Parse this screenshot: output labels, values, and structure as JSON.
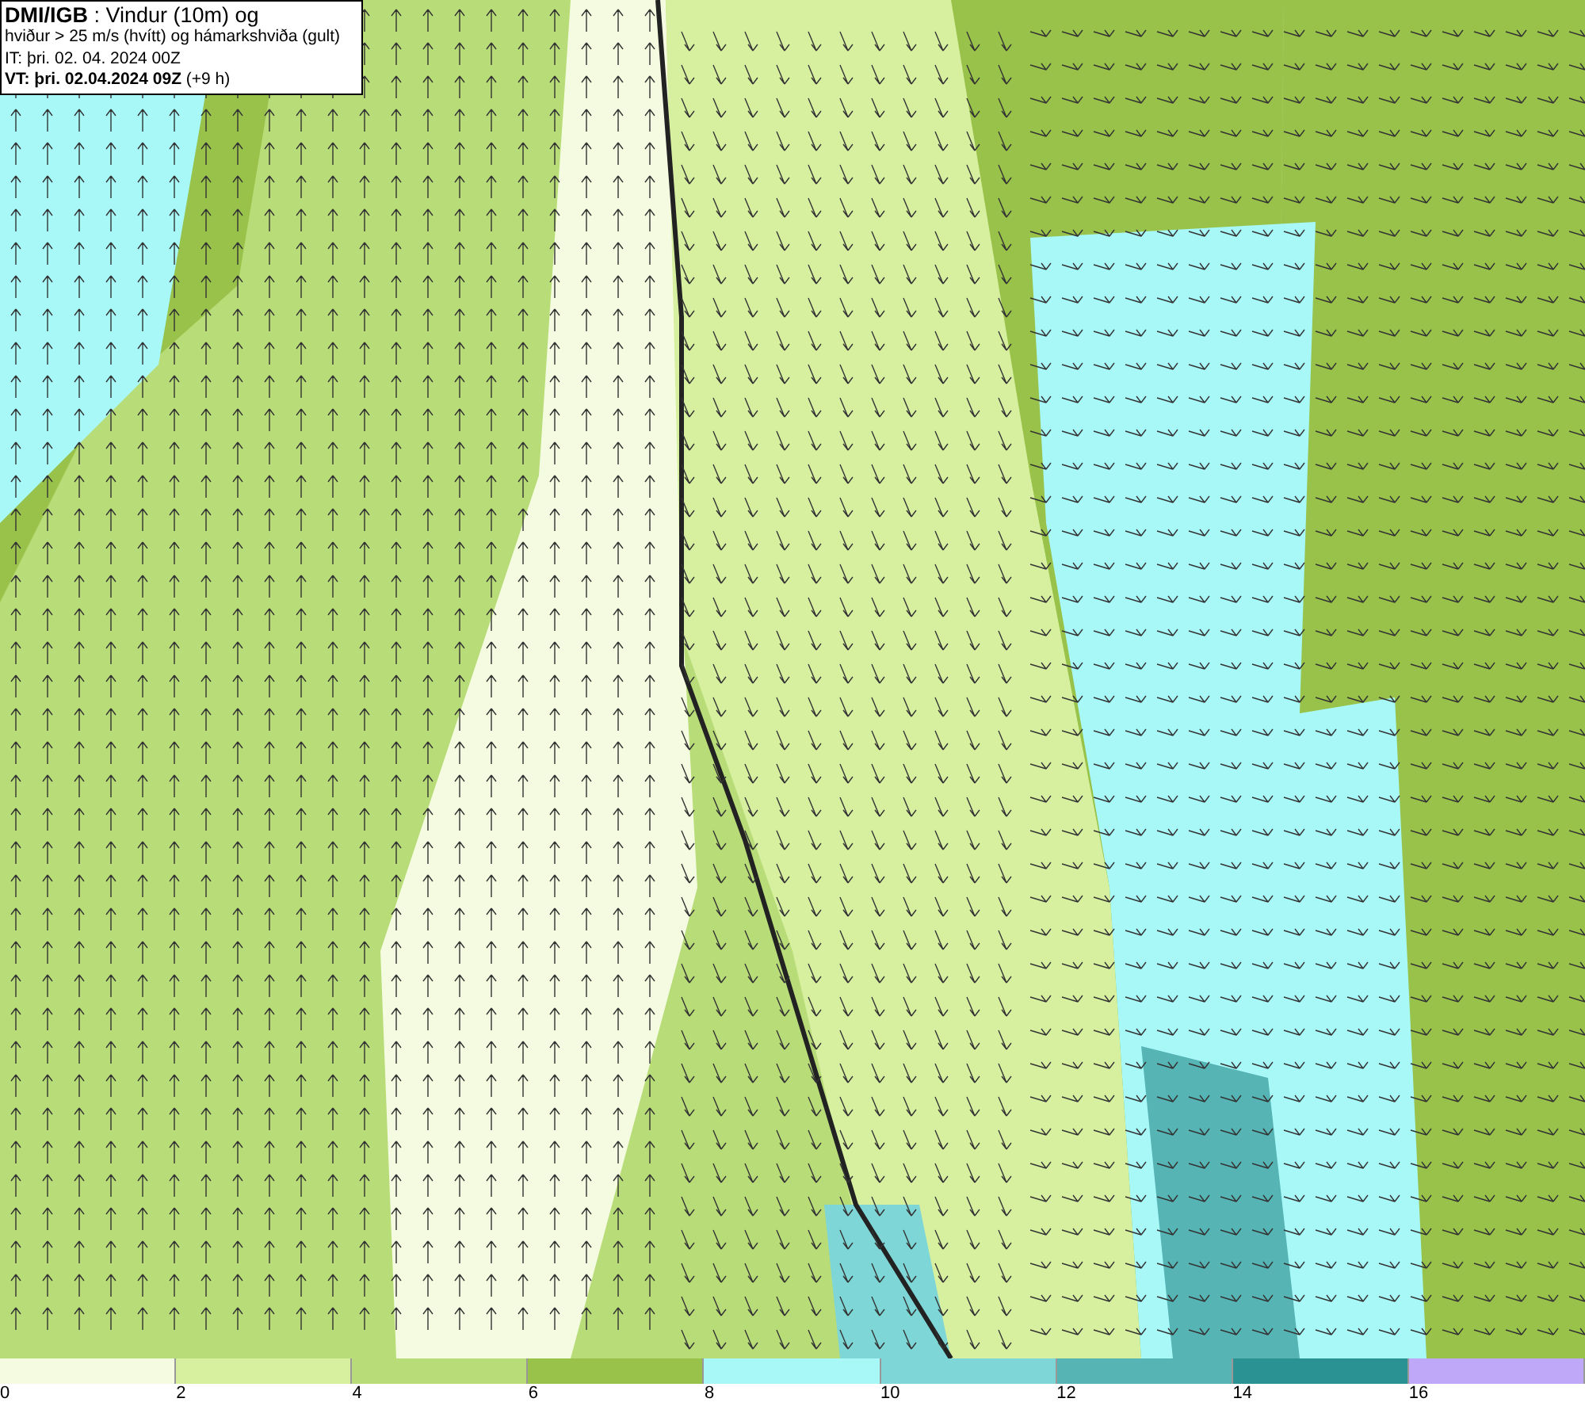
{
  "title_box": {
    "lines": [
      "**DMI/IGB** : Vindur (10m) og",
      "hviður > 25 m/s (hvítt) og hámarkshviða (gult)",
      "IT: þri. 02. 04. 2024 00Z",
      "**VT: þri. 02.04.2024 09Z** (+9 h)"
    ]
  },
  "legend": [
    {
      "label": "0",
      "color": "#f4fbe0"
    },
    {
      "label": "2",
      "color": "#d7f0a0"
    },
    {
      "label": "4",
      "color": "#b8dd78"
    },
    {
      "label": "6",
      "color": "#98c24a"
    },
    {
      "label": "8",
      "color": "#a8f8f8"
    },
    {
      "label": "10",
      "color": "#7ed6d6"
    },
    {
      "label": "12",
      "color": "#56b4b4"
    },
    {
      "label": "14",
      "color": "#2a9292"
    },
    {
      "label": "16",
      "color": "#c0a8f8"
    }
  ]
}
